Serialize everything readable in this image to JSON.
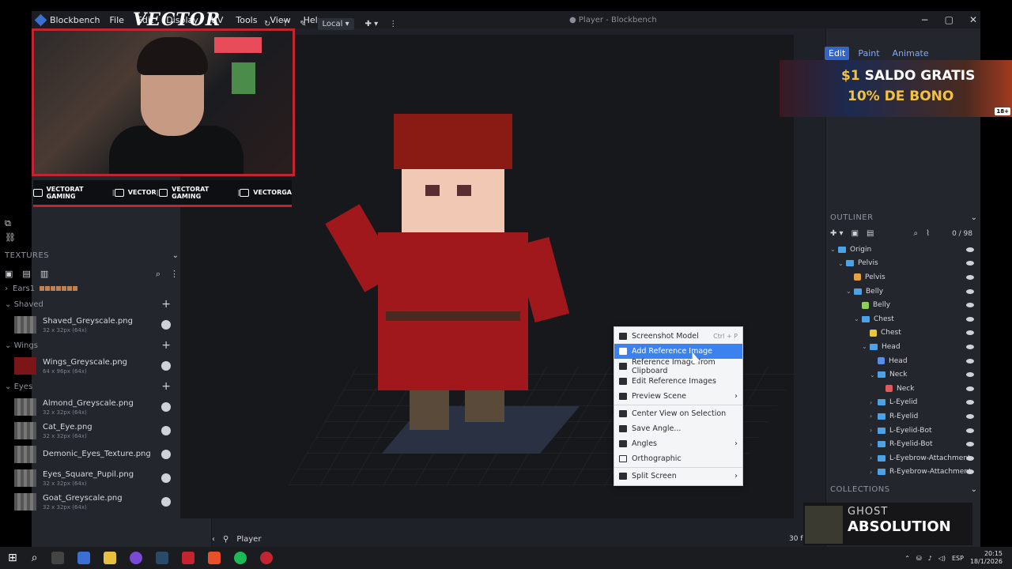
{
  "window": {
    "app_name": "Blockbench",
    "doc_title": "● Player - Blockbench",
    "menu": [
      "File",
      "Edit",
      "Display",
      "UV",
      "Tools",
      "View",
      "Help"
    ],
    "controls": [
      "−",
      "▢",
      "✕"
    ]
  },
  "toolbar": {
    "space": "Local"
  },
  "modes": [
    {
      "label": "Edit",
      "active": true
    },
    {
      "label": "Paint",
      "active": false
    },
    {
      "label": "Animate",
      "active": false
    }
  ],
  "overlay": {
    "brand": "VECTOR",
    "socials": [
      {
        "icon": "youtube-icon",
        "text": "VECTORAT GAMING"
      },
      {
        "icon": "twitch-icon",
        "text": "VECTOR"
      },
      {
        "icon": "twitter-icon",
        "text": "VECTORAT GAMING"
      },
      {
        "icon": "instagram-icon",
        "text": "VECTORGA"
      }
    ],
    "ad_line1_amount": "$1",
    "ad_line1_text": "SALDO GRATIS",
    "ad_line2": "10% DE BONO",
    "ad_age": "18+",
    "music_artist": "GHOST",
    "music_track": "ABSOLUTION"
  },
  "textures": {
    "title": "TEXTURES",
    "ears_label": "Ears1",
    "groups": [
      {
        "name": "Shaved",
        "items": [
          {
            "name": "Shaved_Greyscale.png",
            "size": "32 x 32px (64x)",
            "thumb": "grey"
          }
        ]
      },
      {
        "name": "Wings",
        "items": [
          {
            "name": "Wings_Greyscale.png",
            "size": "64 x 96px (64x)",
            "thumb": "red"
          }
        ]
      },
      {
        "name": "Eyes",
        "items": [
          {
            "name": "Almond_Greyscale.png",
            "size": "32 x 32px (64x)",
            "thumb": "grey"
          },
          {
            "name": "Cat_Eye.png",
            "size": "32 x 32px (64x)",
            "thumb": "grey"
          },
          {
            "name": "Demonic_Eyes_Texture.png",
            "size": "",
            "thumb": "grey"
          },
          {
            "name": "Eyes_Square_Pupil.png",
            "size": "32 x 32px (64x)",
            "thumb": "grey"
          },
          {
            "name": "Goat_Greyscale.png",
            "size": "32 x 32px (64x)",
            "thumb": "grey"
          }
        ]
      }
    ]
  },
  "context_menu": [
    {
      "label": "Screenshot Model",
      "shortcut": "Ctrl + P",
      "icon": "camera-icon",
      "highlight": false
    },
    {
      "label": "Add Reference Image",
      "icon": "image-icon",
      "highlight": true
    },
    {
      "label": "Reference Image from Clipboard",
      "icon": "clipboard-icon",
      "highlight": false
    },
    {
      "label": "Edit Reference Images",
      "icon": "image-edit-icon",
      "highlight": false
    },
    {
      "label": "Preview Scene",
      "icon": "scene-icon",
      "submenu": true,
      "highlight": false
    },
    {
      "sep": true
    },
    {
      "label": "Center View on Selection",
      "icon": "center-icon",
      "highlight": false
    },
    {
      "label": "Save Angle...",
      "icon": "camera-icon",
      "highlight": false
    },
    {
      "label": "Angles",
      "icon": "video-icon",
      "submenu": true,
      "highlight": false
    },
    {
      "label": "Orthographic",
      "icon": "checkbox-icon",
      "checkbox": true,
      "highlight": false
    },
    {
      "sep": true
    },
    {
      "label": "Split Screen",
      "icon": "split-icon",
      "submenu": true,
      "highlight": false
    }
  ],
  "outliner": {
    "title": "OUTLINER",
    "count": "0 / 98",
    "nodes": [
      {
        "label": "Origin",
        "type": "folder",
        "depth": 0,
        "expanded": true
      },
      {
        "label": "Pelvis",
        "type": "folder",
        "depth": 1,
        "expanded": true
      },
      {
        "label": "Pelvis",
        "type": "cube",
        "depth": 2,
        "color": "#e8a040"
      },
      {
        "label": "Belly",
        "type": "folder",
        "depth": 2,
        "expanded": true
      },
      {
        "label": "Belly",
        "type": "cube",
        "depth": 3,
        "color": "#8ccf5a"
      },
      {
        "label": "Chest",
        "type": "folder",
        "depth": 3,
        "expanded": true
      },
      {
        "label": "Chest",
        "type": "cube",
        "depth": 4,
        "color": "#e8c840"
      },
      {
        "label": "Head",
        "type": "folder",
        "depth": 4,
        "expanded": true
      },
      {
        "label": "Head",
        "type": "cube",
        "depth": 5,
        "color": "#5a8ce8"
      },
      {
        "label": "Neck",
        "type": "folder",
        "depth": 5,
        "expanded": true
      },
      {
        "label": "Neck",
        "type": "cube",
        "depth": 6,
        "color": "#e05a5a"
      },
      {
        "label": "L-Eyelid",
        "type": "folder",
        "depth": 5,
        "expanded": false
      },
      {
        "label": "R-Eyelid",
        "type": "folder",
        "depth": 5,
        "expanded": false
      },
      {
        "label": "L-Eyelid-Bot",
        "type": "folder",
        "depth": 5,
        "expanded": false
      },
      {
        "label": "R-Eyelid-Bot",
        "type": "folder",
        "depth": 5,
        "expanded": false
      },
      {
        "label": "L-Eyebrow-Attachment",
        "type": "folder",
        "depth": 5,
        "expanded": false
      },
      {
        "label": "R-Eyebrow-Attachment",
        "type": "folder",
        "depth": 5,
        "expanded": false
      }
    ]
  },
  "collections_title": "COLLECTIONS",
  "status": {
    "model_name": "Player",
    "fps": "30 f"
  },
  "taskbar": {
    "lang": "ESP",
    "time": "20:15",
    "date": "18/1/2026"
  }
}
